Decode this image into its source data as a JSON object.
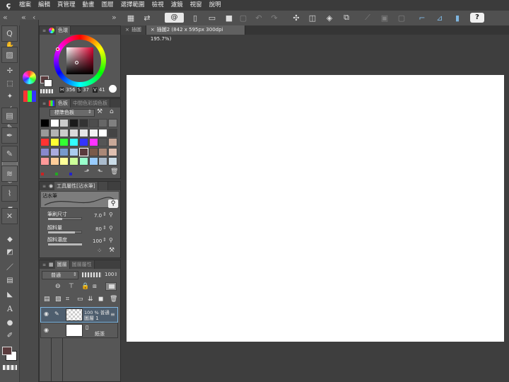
{
  "menu": [
    "檔案",
    "編輯",
    "頁管理",
    "動畫",
    "圖層",
    "選擇範圍",
    "檢視",
    "濾鏡",
    "視窗",
    "說明"
  ],
  "document_tabs": [
    {
      "label": "插圖"
    },
    {
      "label": "插圖2 (842 x 595px 300dpi 195.7%)"
    }
  ],
  "color_panel": {
    "title": "色環",
    "h": "H",
    "h_value": "356",
    "s": "S",
    "s_value": "37",
    "v": "V",
    "v_value": "41",
    "current_color": "#5a3b3d"
  },
  "palette_panel": {
    "title": "色板",
    "tab2": "中間色彩調色板",
    "set_name": "標準色板",
    "swatches": [
      "#000000",
      "#ffffff",
      "#cccccc",
      "#1a1a1a",
      "#333333",
      "#4d4d4d",
      "#666666",
      "#808080",
      "#999999",
      "#b3b3b3",
      "#cccccc",
      "#d9d9d9",
      "#e6e6e6",
      "#f2f2f2",
      "#ffffff",
      "#444444",
      "#ff3333",
      "#ffff33",
      "#33ff33",
      "#33ffff",
      "#3333ff",
      "#ff33ff",
      "#555555",
      "#c8a898",
      "#8888cc",
      "#aaaadd",
      "#7799cc",
      "#aaccee",
      "#5a3b3d",
      "#7a5a4a",
      "#aa8877",
      "#e0c0b0",
      "#ff9999",
      "#ffcc99",
      "#ffff99",
      "#ccff99",
      "#99ffcc",
      "#99ccff",
      "#aabbcc",
      "#ccdde8"
    ]
  },
  "tool_property": {
    "title": "工具屬性[沾水筆]",
    "brush_name": "沾水筆",
    "brush_size_label": "筆刷尺寸",
    "brush_size_value": "7.0",
    "paint_amount_label": "顏料量",
    "paint_amount_value": "80",
    "paint_density_label": "顏料濃度",
    "paint_density_value": "100"
  },
  "layer_panel": {
    "title": "圖層",
    "tab2": "圖層屬性",
    "blend_mode": "普通",
    "opacity": "100",
    "layers": [
      {
        "name": "圖層 1",
        "info": "100 % 普通",
        "selected": true
      },
      {
        "name": "紙張",
        "info": "",
        "selected": false
      }
    ]
  },
  "colors": {
    "accent": "#7fb6e0",
    "panel_bg": "#565656",
    "canvas_bg": "#ffffff"
  }
}
